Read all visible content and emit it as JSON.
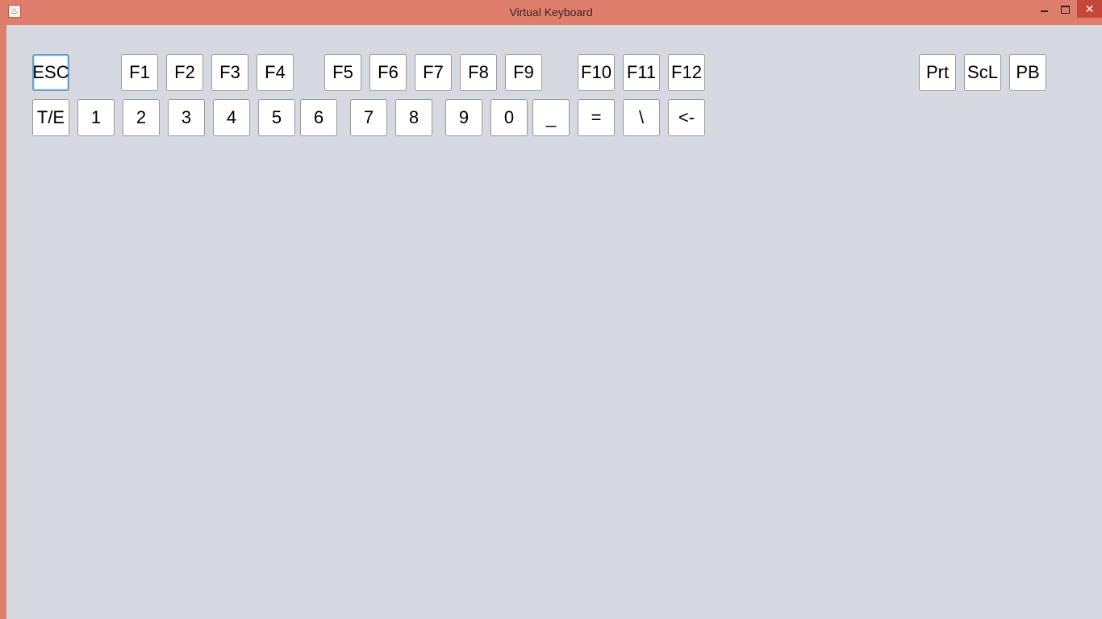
{
  "window": {
    "title": "Virtual Keyboard",
    "controls": {
      "minimize_icon": "minimize-icon",
      "maximize_icon": "maximize-icon",
      "close_icon": "close-icon",
      "close_glyph": "✕"
    }
  },
  "colors": {
    "titlebar": "#DF7E6C",
    "close_button": "#C7463A",
    "background": "#D6D9E0",
    "key_face": "#FFFFFF",
    "focus_ring": "#6A9FD0"
  },
  "keyboard": {
    "focused_key": "ESC",
    "row1": {
      "esc": "ESC",
      "f1": "F1",
      "f2": "F2",
      "f3": "F3",
      "f4": "F4",
      "f5": "F5",
      "f6": "F6",
      "f7": "F7",
      "f8": "F8",
      "f9": "F9",
      "f10": "F10",
      "f11": "F11",
      "f12": "F12",
      "prt": "Prt",
      "scl": "ScL",
      "pb": "PB"
    },
    "row2": {
      "te": "T/E",
      "k1": "1",
      "k2": "2",
      "k3": "3",
      "k4": "4",
      "k5": "5",
      "k6": "6",
      "k7": "7",
      "k8": "8",
      "k9": "9",
      "k0": "0",
      "underscore": "_",
      "equals": "=",
      "backslash": "\\",
      "backspace": "<-"
    }
  }
}
